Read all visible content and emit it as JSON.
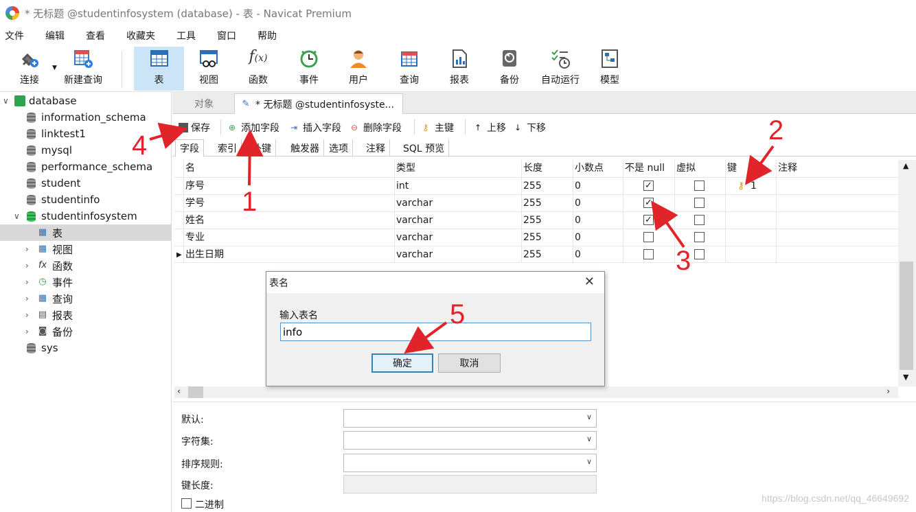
{
  "window": {
    "title": "* 无标题 @studentinfosystem (database) - 表 - Navicat Premium"
  },
  "menu": [
    "文件",
    "编辑",
    "查看",
    "收藏夹",
    "工具",
    "窗口",
    "帮助"
  ],
  "toolbar": {
    "items": [
      {
        "label": "连接",
        "icon": "connect-icon"
      },
      {
        "label": "新建查询",
        "icon": "new-query-icon"
      },
      {
        "label": "表",
        "icon": "table-icon"
      },
      {
        "label": "视图",
        "icon": "view-icon"
      },
      {
        "label": "函数",
        "icon": "function-icon"
      },
      {
        "label": "事件",
        "icon": "event-icon"
      },
      {
        "label": "用户",
        "icon": "user-icon"
      },
      {
        "label": "查询",
        "icon": "query-icon"
      },
      {
        "label": "报表",
        "icon": "report-icon"
      },
      {
        "label": "备份",
        "icon": "backup-icon"
      },
      {
        "label": "自动运行",
        "icon": "autorun-icon"
      },
      {
        "label": "模型",
        "icon": "model-icon"
      }
    ]
  },
  "tree": {
    "root": "database",
    "dbs": [
      "information_schema",
      "linktest1",
      "mysql",
      "performance_schema",
      "student",
      "studentinfo",
      "studentinfosystem"
    ],
    "children": [
      "表",
      "视图",
      "函数",
      "事件",
      "查询",
      "报表",
      "备份"
    ],
    "child_icons": [
      "table-icon",
      "view-icon",
      "fx",
      "event-icon",
      "query-icon",
      "report-icon",
      "backup-icon"
    ],
    "fx": "fx",
    "last": "sys"
  },
  "tabs": {
    "objects": "对象",
    "current": "* 无标题 @studentinfosyste..."
  },
  "subtoolbar": {
    "save": "保存",
    "add_field": "添加字段",
    "insert_field": "插入字段",
    "delete_field": "删除字段",
    "primary_key": "主键",
    "move_up": "上移",
    "move_down": "下移"
  },
  "inner_tabs": [
    "字段",
    "索引",
    "外键",
    "触发器",
    "选项",
    "注释",
    "SQL 预览"
  ],
  "grid": {
    "headers": [
      "名",
      "类型",
      "长度",
      "小数点",
      "不是 null",
      "虚拟",
      "键",
      "注释"
    ],
    "rows": [
      {
        "name": "序号",
        "type": "int",
        "length": "255",
        "decimals": "0",
        "not_null": true,
        "virtual": false,
        "key": "1"
      },
      {
        "name": "学号",
        "type": "varchar",
        "length": "255",
        "decimals": "0",
        "not_null": true,
        "virtual": false,
        "key": ""
      },
      {
        "name": "姓名",
        "type": "varchar",
        "length": "255",
        "decimals": "0",
        "not_null": true,
        "virtual": false,
        "key": ""
      },
      {
        "name": "专业",
        "type": "varchar",
        "length": "255",
        "decimals": "0",
        "not_null": false,
        "virtual": false,
        "key": ""
      },
      {
        "name": "出生日期",
        "type": "varchar",
        "length": "255",
        "decimals": "0",
        "not_null": false,
        "virtual": false,
        "key": ""
      }
    ]
  },
  "props": {
    "default": "默认:",
    "charset": "字符集:",
    "collation": "排序规则:",
    "key_length": "键长度:",
    "binary": "二进制"
  },
  "dialog": {
    "title": "表名",
    "label": "输入表名",
    "value": "info",
    "ok": "确定",
    "cancel": "取消"
  },
  "annotations": [
    "1",
    "2",
    "3",
    "4",
    "5"
  ],
  "annotation_color": "#e0242a",
  "watermark": "https://blog.csdn.net/qq_46649692"
}
